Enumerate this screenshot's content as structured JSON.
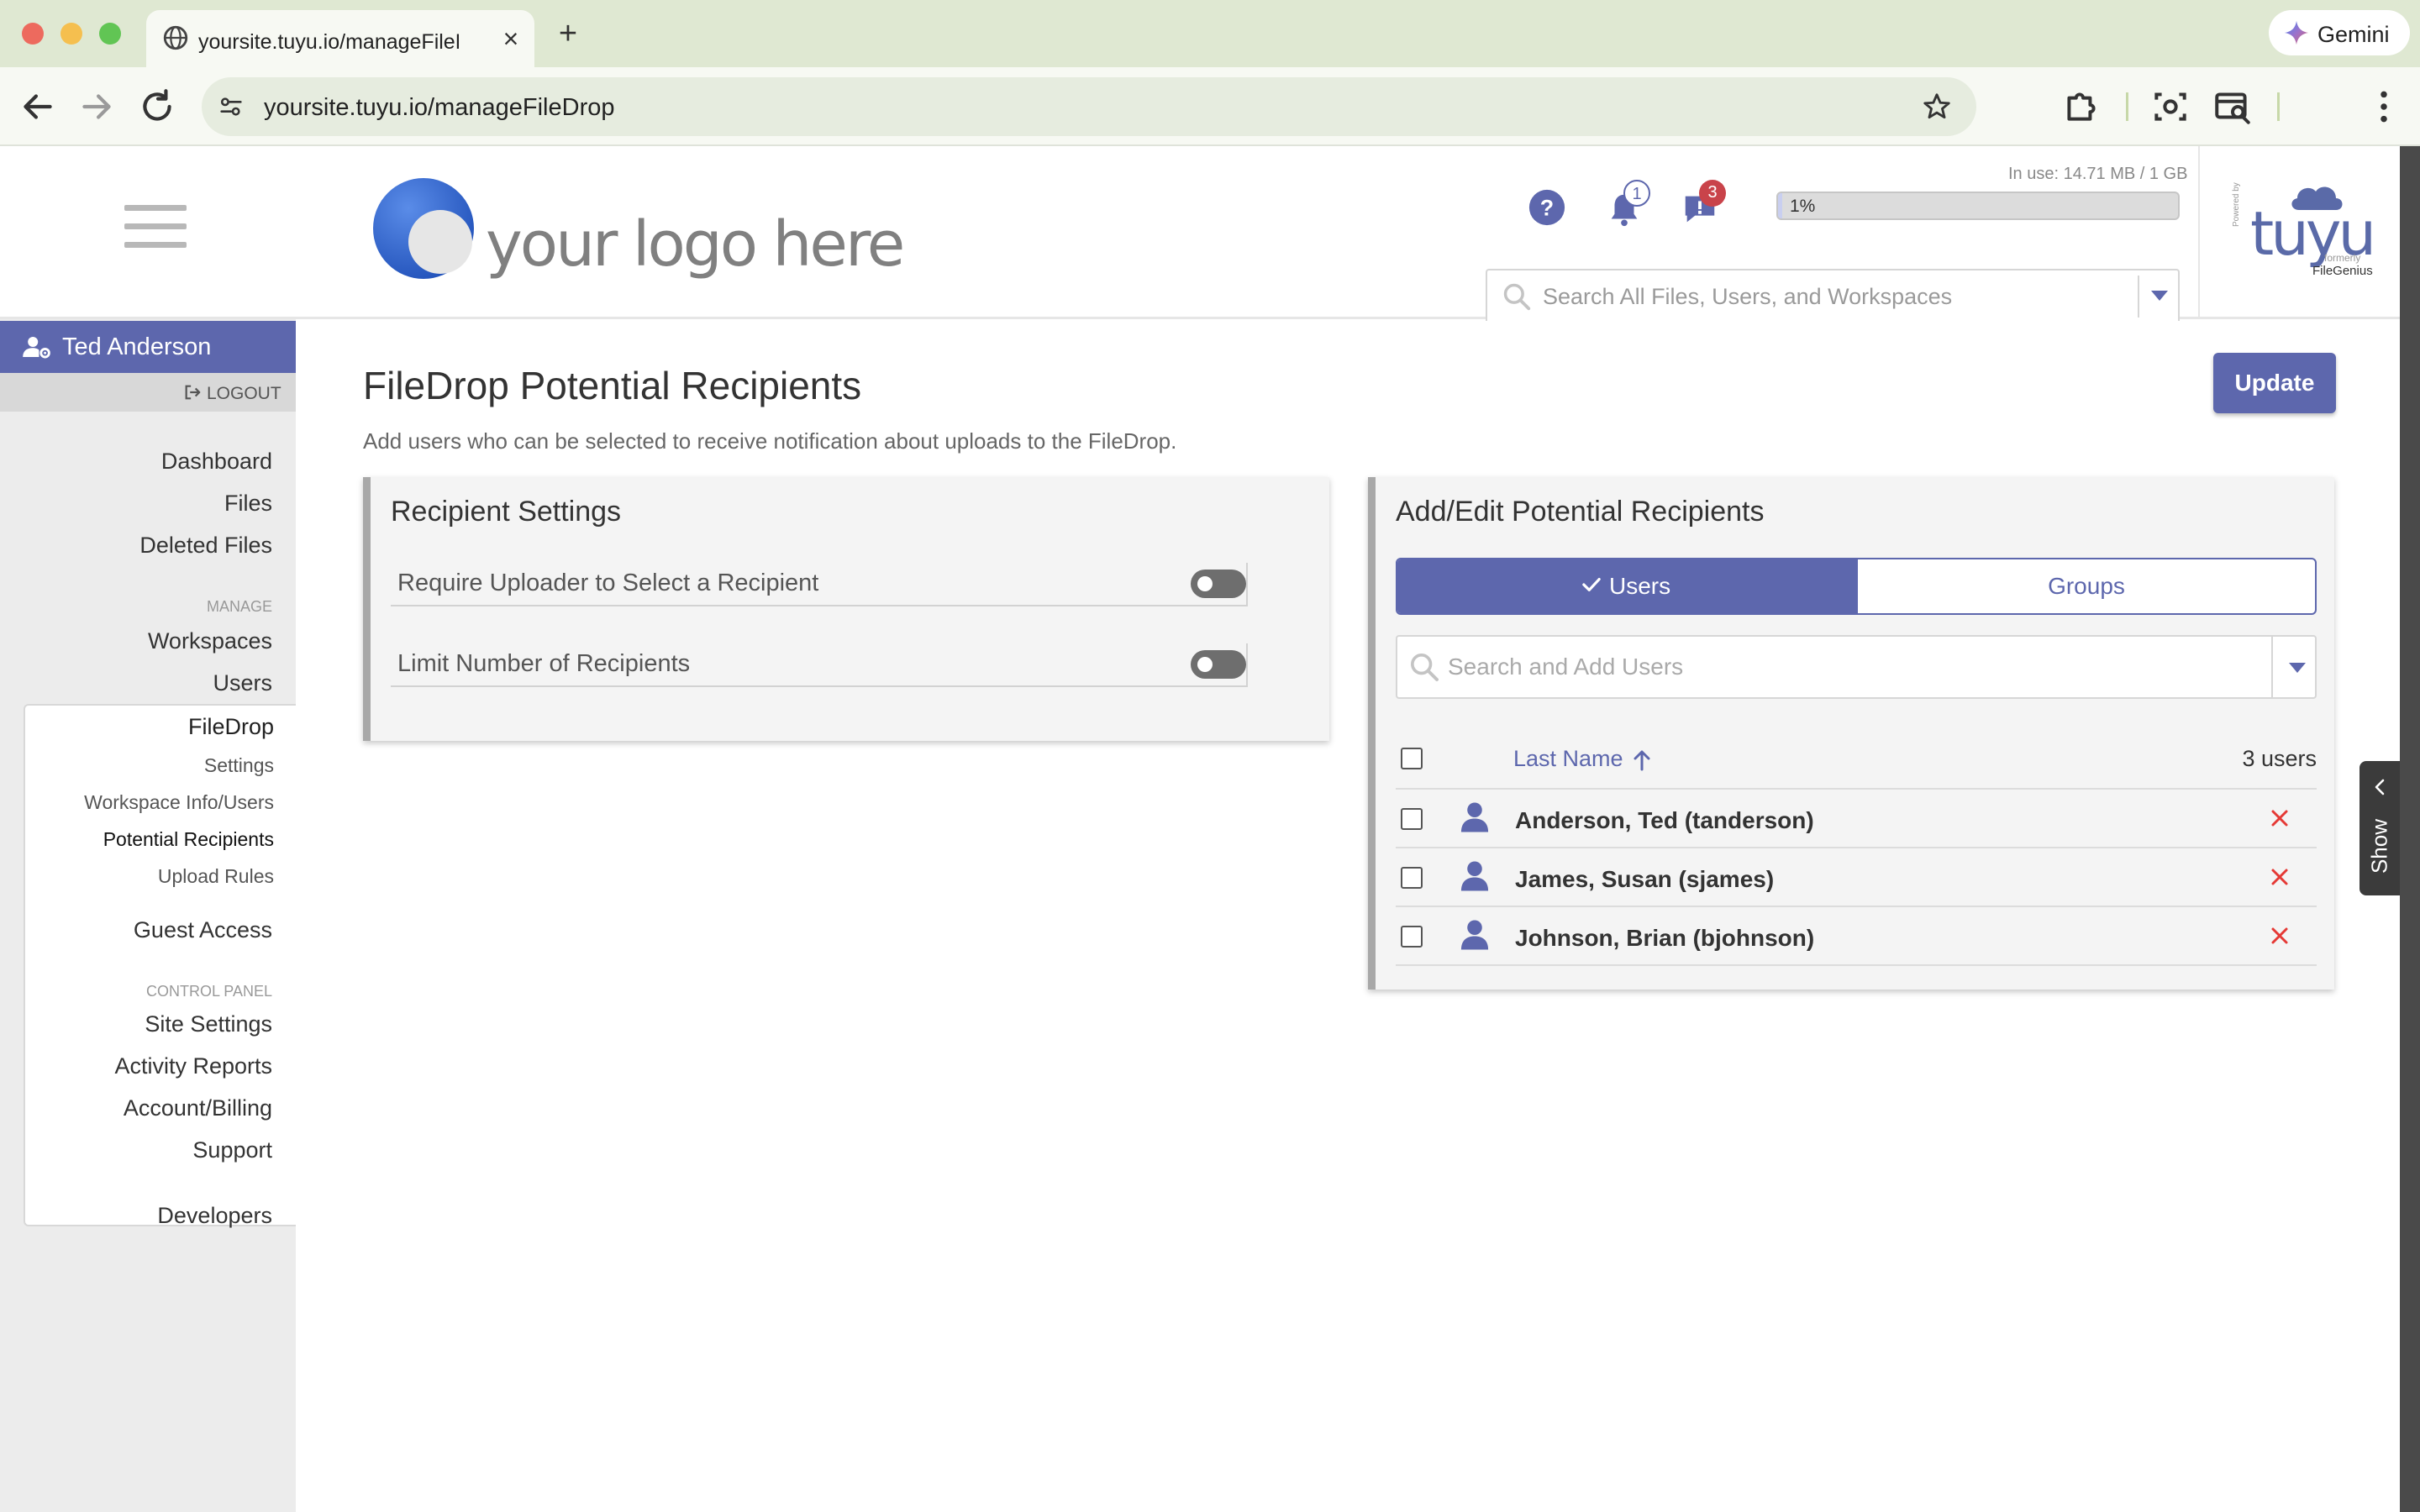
{
  "browser": {
    "tab_title": "yoursite.tuyu.io/manageFileDrop",
    "url": "yoursite.tuyu.io/manageFileDrop",
    "gemini_label": "Gemini",
    "colors": {
      "close": "#ed6a5e",
      "minimize": "#f5bf4f",
      "maximize": "#61c554"
    }
  },
  "header": {
    "logo_text": "your logo here",
    "notifications_count": "1",
    "messages_count": "3",
    "storage": {
      "in_use_label": "In use: 14.71 MB / 1 GB",
      "percent_label": "1%",
      "fraction": 0.01
    },
    "search_placeholder": "Search All Files, Users, and Workspaces",
    "brand": {
      "powered_by": "Powered by",
      "name": "tuyu",
      "formerly": "formerly",
      "legacy_name": "FileGenius"
    }
  },
  "sidebar": {
    "user_name": "Ted Anderson",
    "logout_label": "LOGOUT",
    "top_items": [
      "Dashboard",
      "Files",
      "Deleted Files"
    ],
    "manage_label": "MANAGE",
    "manage_items": [
      "Workspaces",
      "Users"
    ],
    "filedrop": {
      "label": "FileDrop",
      "sub_items": [
        "Settings",
        "Workspace Info/Users",
        "Potential Recipients",
        "Upload Rules"
      ],
      "active_sub": "Potential Recipients"
    },
    "guest_access": "Guest Access",
    "control_panel_label": "CONTROL PANEL",
    "control_items": [
      "Site Settings",
      "Activity Reports",
      "Account/Billing",
      "Support"
    ],
    "developers": "Developers"
  },
  "main": {
    "title": "FileDrop Potential Recipients",
    "subtitle": "Add users who can be selected to receive notification about uploads to the FileDrop.",
    "update_button": "Update",
    "recipient_settings": {
      "title": "Recipient Settings",
      "toggles": [
        {
          "label": "Require Uploader to Select a Recipient",
          "on": false
        },
        {
          "label": "Limit Number of Recipients",
          "on": false
        }
      ]
    },
    "potential_recipients": {
      "title": "Add/Edit Potential Recipients",
      "tabs": {
        "users": "Users",
        "groups": "Groups",
        "active": "users"
      },
      "search_placeholder": "Search and Add Users",
      "column_header": "Last Name",
      "count_label": "3 users",
      "rows": [
        "Anderson, Ted (tanderson)",
        "James, Susan (sjames)",
        "Johnson, Brian (bjohnson)"
      ]
    },
    "show_panel_label": "Show"
  },
  "theme": {
    "accent": "#5d67ad",
    "danger": "#e53935",
    "badge_message": "#c9434a",
    "sidebar_bg": "#ececec"
  }
}
